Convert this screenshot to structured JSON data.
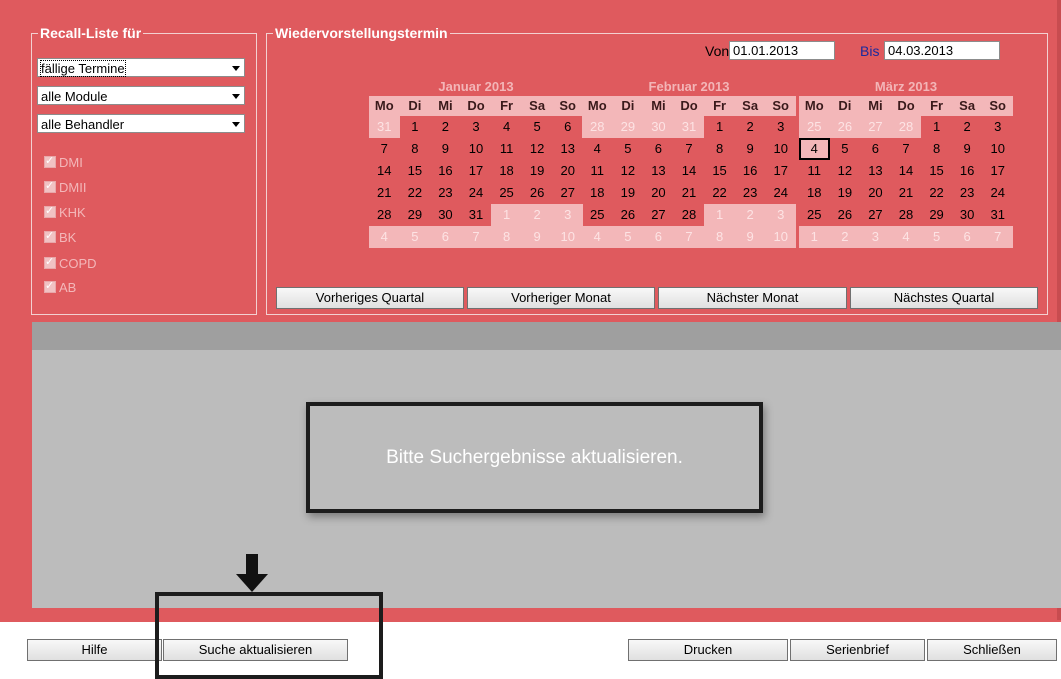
{
  "recall_group": {
    "title": "Recall-Liste für",
    "selects": [
      "fällige Termine",
      "alle Module",
      "alle Behandler"
    ],
    "checkboxes": [
      "DMI",
      "DMII",
      "KHK",
      "BK",
      "COPD",
      "AB"
    ]
  },
  "appointment_group": {
    "title": "Wiedervorstellungstermin",
    "from_label": "Von",
    "from_value": "01.01.2013",
    "to_label": "Bis",
    "to_value": "04.03.2013"
  },
  "calendar": {
    "weekdays": [
      "Mo",
      "Di",
      "Mi",
      "Do",
      "Fr",
      "Sa",
      "So"
    ],
    "months": [
      {
        "title": "Januar 2013",
        "weeks": [
          [
            "31",
            "1",
            "2",
            "3",
            "4",
            "5",
            "6"
          ],
          [
            "7",
            "8",
            "9",
            "10",
            "11",
            "12",
            "13"
          ],
          [
            "14",
            "15",
            "16",
            "17",
            "18",
            "19",
            "20"
          ],
          [
            "21",
            "22",
            "23",
            "24",
            "25",
            "26",
            "27"
          ],
          [
            "28",
            "29",
            "30",
            "31",
            "1",
            "2",
            "3"
          ],
          [
            "4",
            "5",
            "6",
            "7",
            "8",
            "9",
            "10"
          ]
        ],
        "lead_other": 1,
        "trail_other": 10
      },
      {
        "title": "Februar 2013",
        "weeks": [
          [
            "28",
            "29",
            "30",
            "31",
            "1",
            "2",
            "3"
          ],
          [
            "4",
            "5",
            "6",
            "7",
            "8",
            "9",
            "10"
          ],
          [
            "11",
            "12",
            "13",
            "14",
            "15",
            "16",
            "17"
          ],
          [
            "18",
            "19",
            "20",
            "21",
            "22",
            "23",
            "24"
          ],
          [
            "25",
            "26",
            "27",
            "28",
            "1",
            "2",
            "3"
          ],
          [
            "4",
            "5",
            "6",
            "7",
            "8",
            "9",
            "10"
          ]
        ],
        "lead_other": 4,
        "trail_other": 10
      },
      {
        "title": "März 2013",
        "weeks": [
          [
            "25",
            "26",
            "27",
            "28",
            "1",
            "2",
            "3"
          ],
          [
            "4",
            "5",
            "6",
            "7",
            "8",
            "9",
            "10"
          ],
          [
            "11",
            "12",
            "13",
            "14",
            "15",
            "16",
            "17"
          ],
          [
            "18",
            "19",
            "20",
            "21",
            "22",
            "23",
            "24"
          ],
          [
            "25",
            "26",
            "27",
            "28",
            "29",
            "30",
            "31"
          ],
          [
            "1",
            "2",
            "3",
            "4",
            "5",
            "6",
            "7"
          ]
        ],
        "lead_other": 4,
        "trail_other": 7,
        "today": 7
      }
    ]
  },
  "nav_buttons": [
    "Vorheriges Quartal",
    "Vorheriger Monat",
    "Nächster Monat",
    "Nächstes Quartal"
  ],
  "results": {
    "message": "Bitte Suchergebnisse aktualisieren."
  },
  "footer": {
    "help": "Hilfe",
    "refresh": "Suche aktualisieren",
    "print": "Drucken",
    "serial_letter": "Serienbrief",
    "close": "Schließen"
  }
}
